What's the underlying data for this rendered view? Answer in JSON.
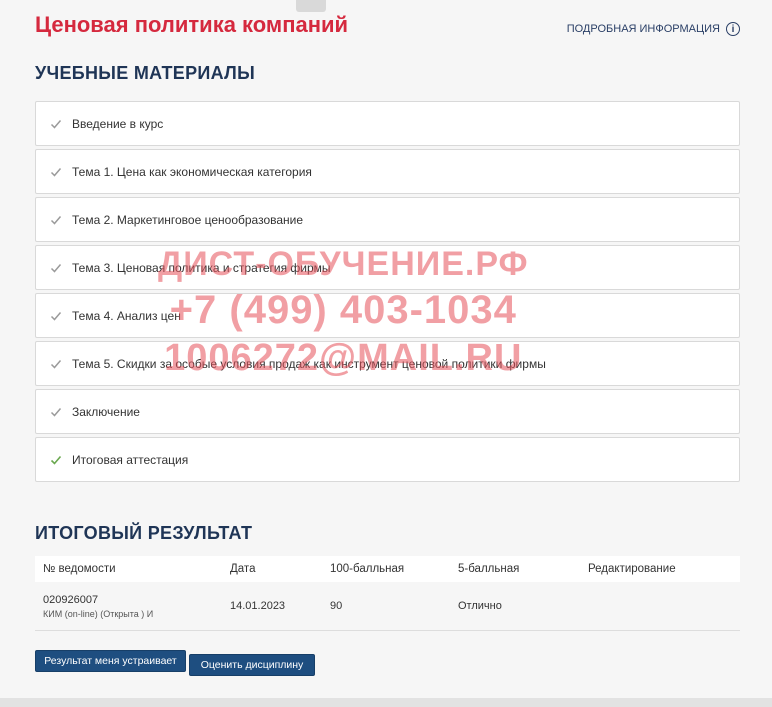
{
  "header": {
    "course_title": "Ценовая политика компаний",
    "details_link": "ПОДРОБНАЯ ИНФОРМАЦИЯ"
  },
  "materials": {
    "title": "УЧЕБНЫЕ МАТЕРИАЛЫ",
    "items": [
      {
        "label": "Введение в курс",
        "status": "viewed"
      },
      {
        "label": "Тема 1. Цена как экономическая категория",
        "status": "viewed"
      },
      {
        "label": "Тема 2. Маркетинговое ценообразование",
        "status": "viewed"
      },
      {
        "label": "Тема 3. Ценовая политика и стратегия фирмы",
        "status": "viewed"
      },
      {
        "label": "Тема 4. Анализ цен",
        "status": "viewed"
      },
      {
        "label": "Тема 5. Скидки за особые условия продаж как инструмент ценовой политики фирмы",
        "status": "viewed"
      },
      {
        "label": "Заключение",
        "status": "viewed"
      },
      {
        "label": "Итоговая аттестация",
        "status": "completed"
      }
    ]
  },
  "results": {
    "title": "ИТОГОВЫЙ РЕЗУЛЬТАТ",
    "headers": [
      "№ ведомости",
      "Дата",
      "100-балльная",
      "5-балльная",
      "Редактирование"
    ],
    "row": {
      "number": "020926007",
      "subtitle": "КИМ (on-line) (Открыта ) И",
      "date": "14.01.2023",
      "score100": "90",
      "score5": "Отлично",
      "edit": ""
    }
  },
  "buttons": {
    "accept": "Результат меня устраивает",
    "rate": "Оценить дисциплину"
  },
  "watermark": {
    "line1": "ДИСТ-ОБУЧЕНИЕ.РФ",
    "line2": "+7 (499) 403-1034",
    "line3": "1006272@MAIL.RU"
  },
  "colors": {
    "check_viewed": "#9a9a9a",
    "check_completed": "#6aa84f",
    "accent_title": "#d5293e",
    "button_bg": "#1e4e80"
  }
}
